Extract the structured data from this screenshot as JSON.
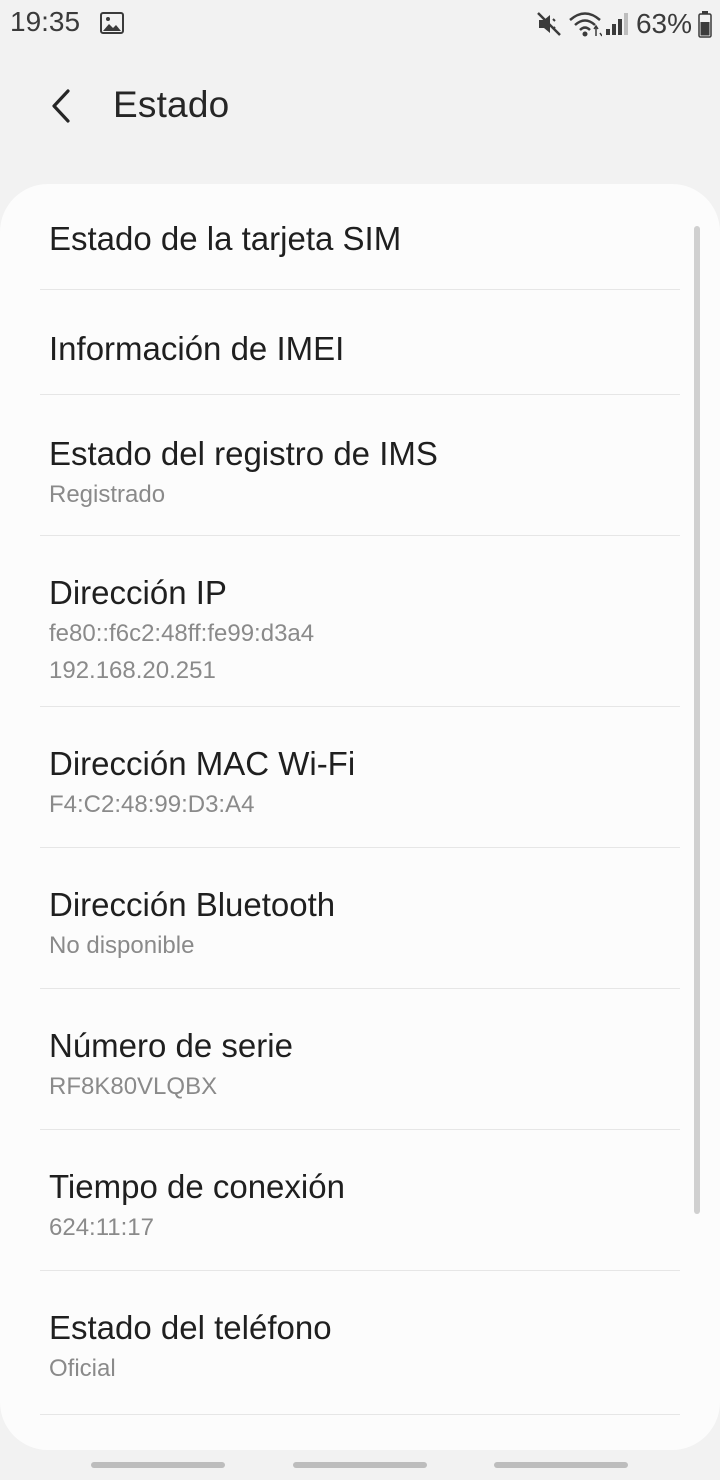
{
  "status_bar": {
    "time": "19:35",
    "battery": "63%",
    "icons": [
      "gallery-icon",
      "mute-icon",
      "wifi-icon",
      "signal-icon",
      "battery-icon"
    ]
  },
  "header": {
    "title": "Estado",
    "back_icon": "chevron-left-icon"
  },
  "items": [
    {
      "title": "Estado de la tarjeta SIM"
    },
    {
      "title": "Información de IMEI"
    },
    {
      "title": "Estado del registro de IMS",
      "subtitle": "Registrado"
    },
    {
      "title": "Dirección IP",
      "subtitle": "fe80::f6c2:48ff:fe99:d3a4",
      "subtitle2": "192.168.20.251"
    },
    {
      "title": "Dirección MAC Wi-Fi",
      "subtitle": "F4:C2:48:99:D3:A4"
    },
    {
      "title": "Dirección Bluetooth",
      "subtitle": "No disponible"
    },
    {
      "title": "Número de serie",
      "subtitle": "RF8K80VLQBX"
    },
    {
      "title": "Tiempo de conexión",
      "subtitle": "624:11:17"
    },
    {
      "title": "Estado del teléfono",
      "subtitle": "Oficial"
    }
  ],
  "colors": {
    "background": "#f2f2f2",
    "card": "#fcfcfc",
    "primary_text": "#1f1f1f",
    "secondary_text": "#8a8a8a",
    "divider": "#e6e6e6"
  }
}
